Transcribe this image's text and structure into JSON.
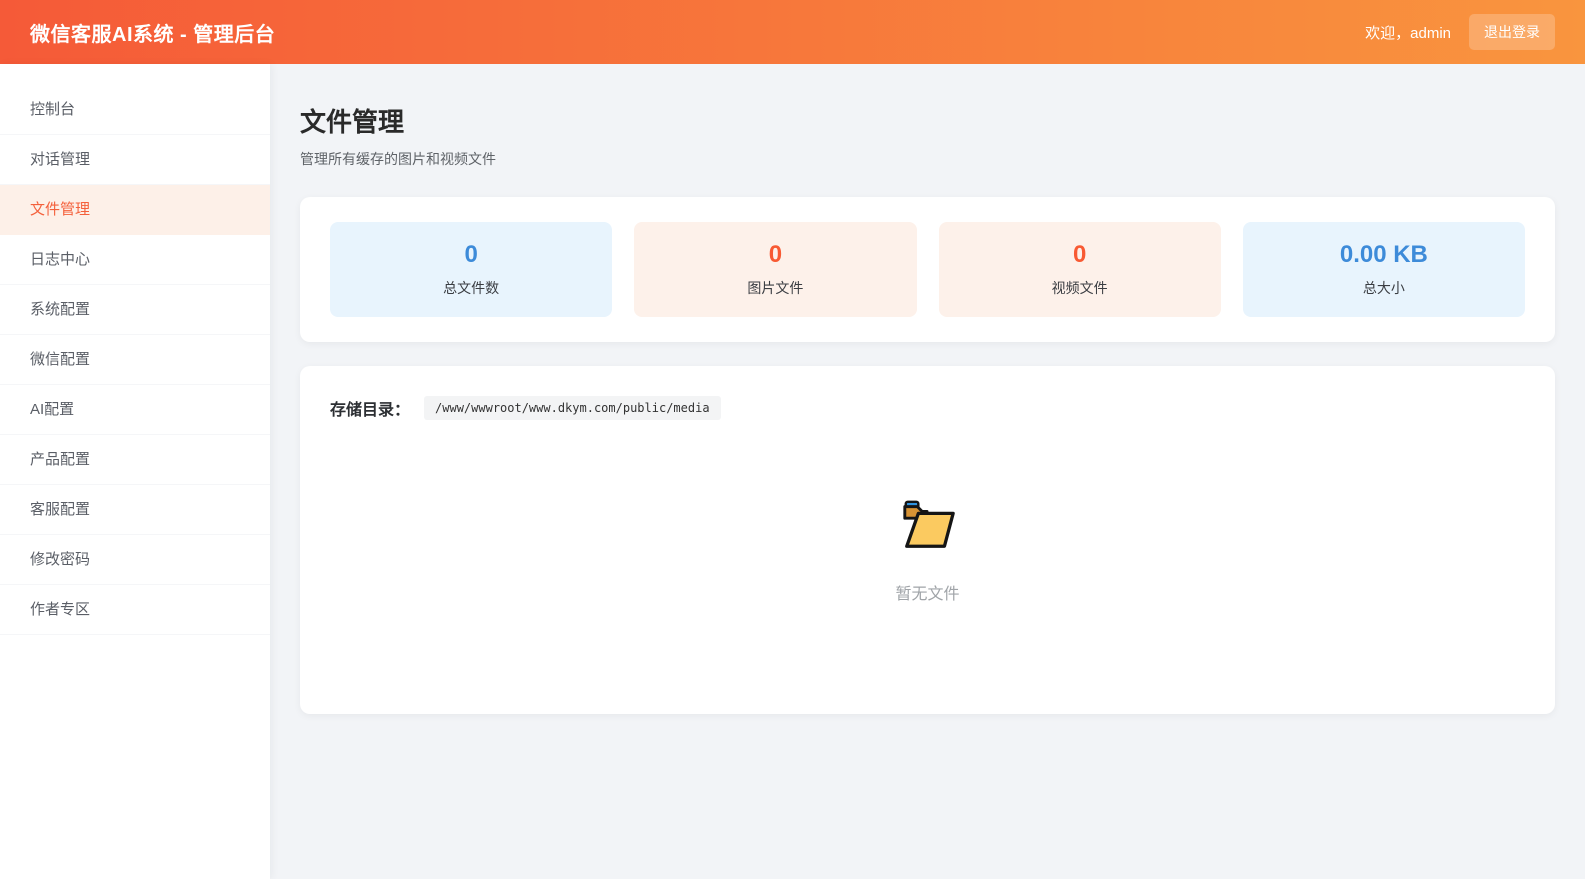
{
  "header": {
    "title": "微信客服AI系统 - 管理后台",
    "welcome": "欢迎，admin",
    "logout_label": "退出登录"
  },
  "sidebar": {
    "items": [
      {
        "key": "console",
        "label": "控制台",
        "active": false
      },
      {
        "key": "conversations",
        "label": "对话管理",
        "active": false
      },
      {
        "key": "files",
        "label": "文件管理",
        "active": true
      },
      {
        "key": "logs",
        "label": "日志中心",
        "active": false
      },
      {
        "key": "system-config",
        "label": "系统配置",
        "active": false
      },
      {
        "key": "wechat-config",
        "label": "微信配置",
        "active": false
      },
      {
        "key": "ai-config",
        "label": "AI配置",
        "active": false
      },
      {
        "key": "product-config",
        "label": "产品配置",
        "active": false
      },
      {
        "key": "service-config",
        "label": "客服配置",
        "active": false
      },
      {
        "key": "change-password",
        "label": "修改密码",
        "active": false
      },
      {
        "key": "author-zone",
        "label": "作者专区",
        "active": false
      }
    ]
  },
  "page": {
    "title": "文件管理",
    "subtitle": "管理所有缓存的图片和视频文件"
  },
  "stats": {
    "cards": [
      {
        "key": "total-files",
        "value": "0",
        "label": "总文件数",
        "theme": "blue"
      },
      {
        "key": "image-files",
        "value": "0",
        "label": "图片文件",
        "theme": "orange"
      },
      {
        "key": "video-files",
        "value": "0",
        "label": "视频文件",
        "theme": "orange"
      },
      {
        "key": "total-size",
        "value": "0.00 KB",
        "label": "总大小",
        "theme": "blue"
      }
    ]
  },
  "files": {
    "storage_label": "存储目录：",
    "storage_path": "/www/wwwroot/www.dkym.com/public/media",
    "empty_text": "暂无文件",
    "empty_icon": "open-folder-icon"
  },
  "colors": {
    "header_gradient_start": "#f55a38",
    "header_gradient_end": "#f9953e",
    "accent_orange": "#f4613c",
    "active_menu_bg": "#fdf0e8",
    "stat_blue": "#3d8bd9",
    "stat_blue_bg": "#e8f4fd",
    "stat_orange": "#f85a33",
    "stat_orange_bg": "#fdf1ea",
    "main_bg": "#f2f4f7"
  }
}
